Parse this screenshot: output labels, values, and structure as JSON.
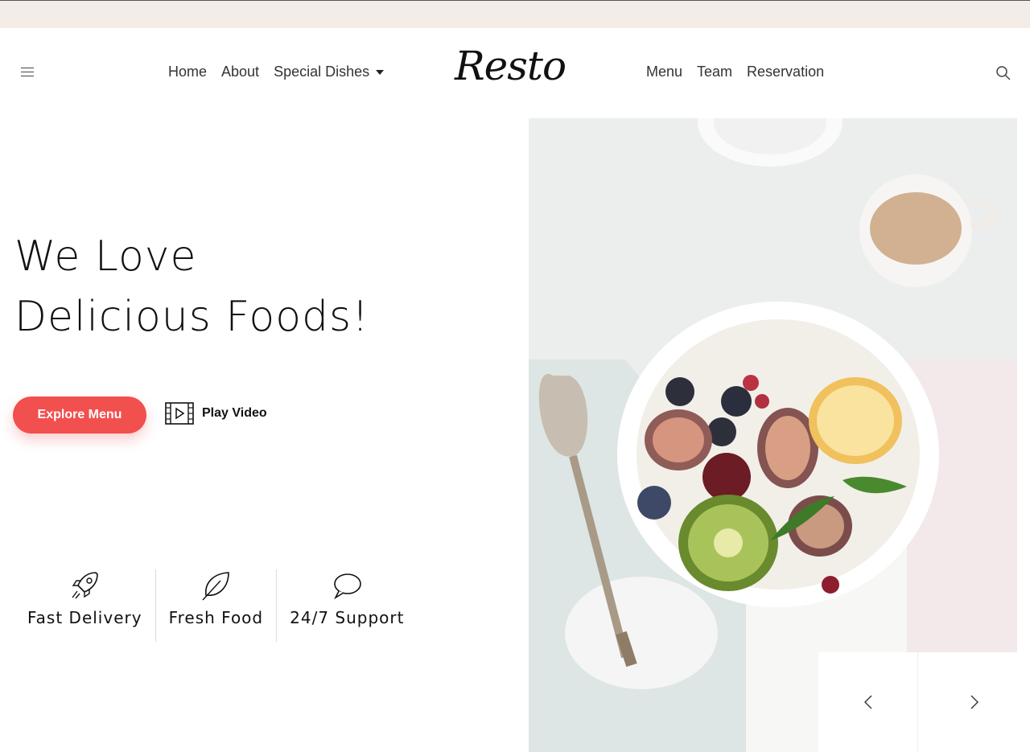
{
  "brand": {
    "logo_text": "Resto"
  },
  "nav": {
    "left": [
      {
        "label": "Home"
      },
      {
        "label": "About"
      },
      {
        "label": "Special Dishes",
        "has_dropdown": true
      }
    ],
    "right": [
      {
        "label": "Menu"
      },
      {
        "label": "Team"
      },
      {
        "label": "Reservation"
      }
    ]
  },
  "hero": {
    "title_line1": "We Love",
    "title_line2": "Delicious Foods!",
    "explore_label": "Explore Menu",
    "play_label": "Play Video"
  },
  "features": [
    {
      "label": "Fast Delivery",
      "icon": "rocket-icon"
    },
    {
      "label": "Fresh Food",
      "icon": "leaf-icon"
    },
    {
      "label": "24/7 Support",
      "icon": "chat-bubble-icon"
    }
  ],
  "colors": {
    "accent": "#f24f4f",
    "topbar": "#f4ede7"
  }
}
